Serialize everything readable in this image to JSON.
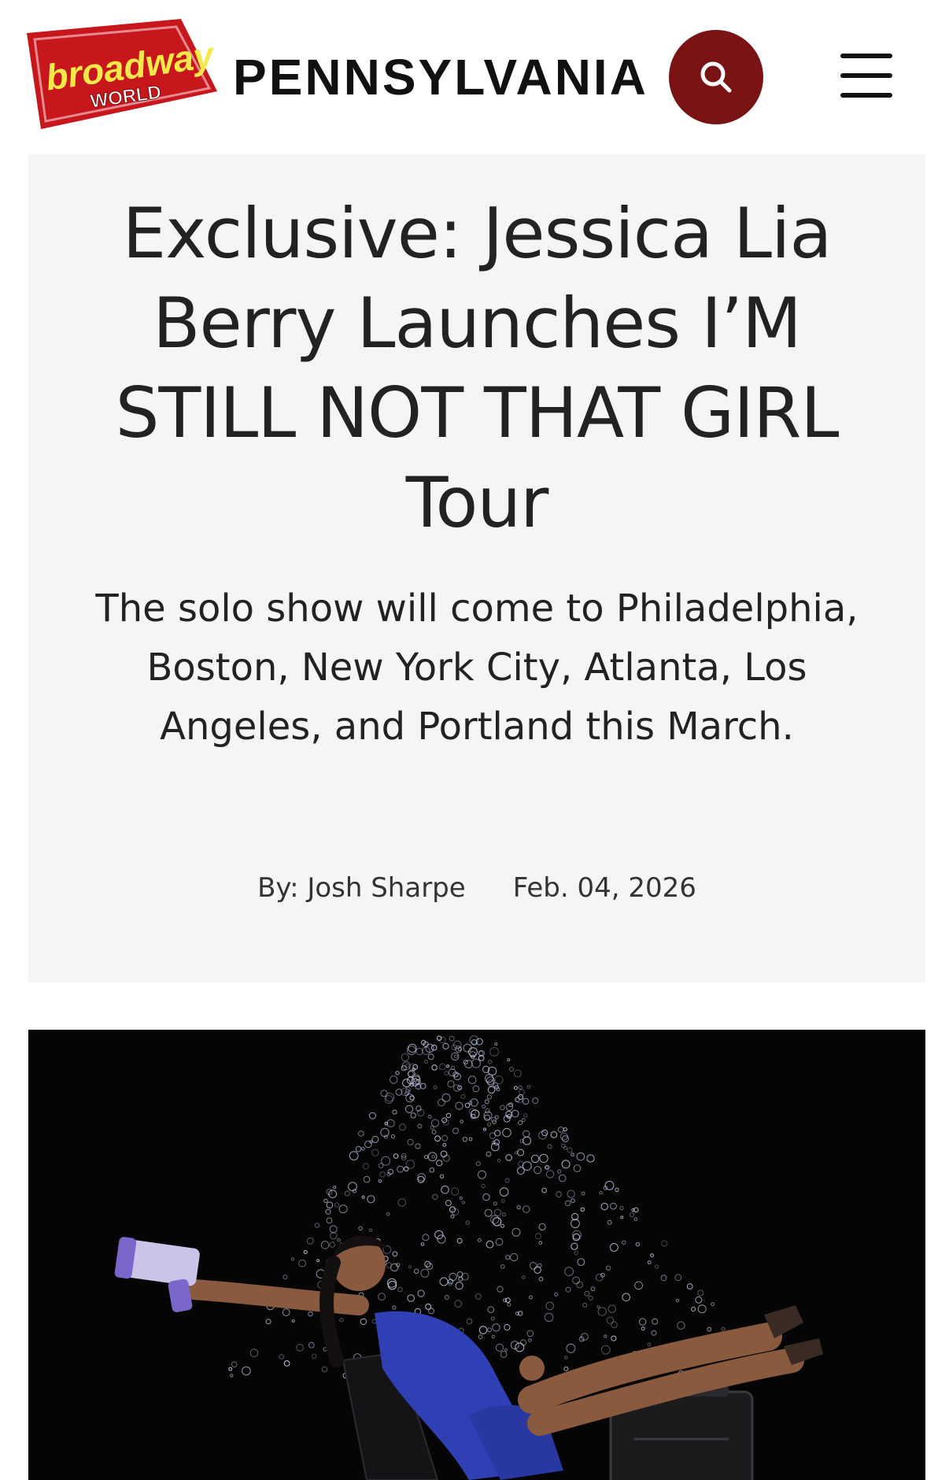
{
  "header": {
    "logo": {
      "line1": "broadway",
      "line2": "WORLD",
      "colors": {
        "red": "#c8161d",
        "yellow": "#f5e94a",
        "white": "#ffffff"
      }
    },
    "region": "PENNSYLVANIA",
    "search_icon": "search-icon",
    "menu_icon": "hamburger-menu-icon",
    "accent_color": "#7a1414"
  },
  "article": {
    "title": "Exclusive: Jessica Lia Berry Launches I’M STILL NOT THAT GIRL Tour",
    "subtitle": "The solo show will come to Philadelphia, Boston, New York City, Atlanta, Los Angeles, and Portland this March.",
    "author": "By: Josh Sharpe",
    "date": "Feb. 04, 2026"
  },
  "hero_image": {
    "description_icon": "photo-performer-bubbles",
    "background_color": "#050505",
    "dress_color": "#2f3fb4"
  }
}
